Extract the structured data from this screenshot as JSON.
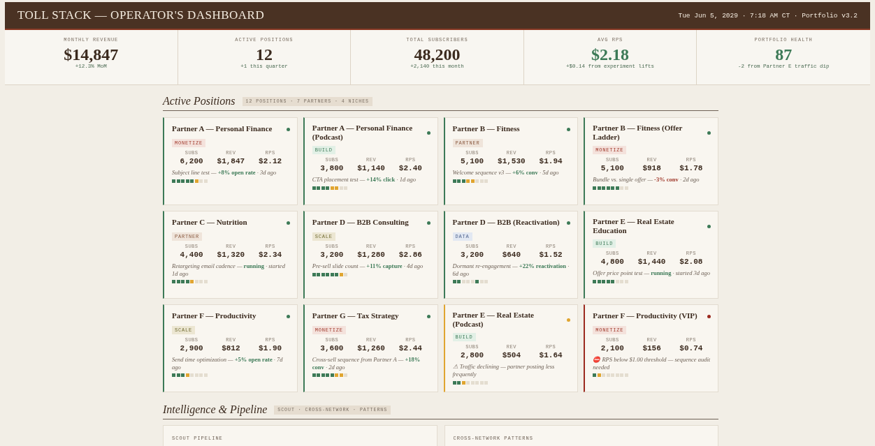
{
  "header": {
    "title": "TOLL STACK — OPERATOR'S DASHBOARD",
    "meta": "Tue Jun 5, 2029 · 7:18 AM CT · Portfolio v3.2"
  },
  "stats": [
    {
      "label": "MONTHLY REVENUE",
      "value": "$14,847",
      "delta": "+12.3% MoM",
      "highlight": false
    },
    {
      "label": "ACTIVE POSITIONS",
      "value": "12",
      "delta": "+1 this quarter",
      "highlight": false
    },
    {
      "label": "TOTAL SUBSCRIBERS",
      "value": "48,200",
      "delta": "+2,140 this month",
      "highlight": false
    },
    {
      "label": "AVG RPS",
      "value": "$2.18",
      "delta": "+$0.14 from experiment lifts",
      "highlight": true
    },
    {
      "label": "PORTFOLIO HEALTH",
      "value": "87",
      "delta": "-2 from Partner E traffic dip",
      "highlight": true
    }
  ],
  "positions": {
    "title": "Active Positions",
    "badge": "12 POSITIONS · 7 PARTNERS · 4 NICHES",
    "cards": [
      {
        "title": "Partner A — Personal Finance",
        "color": "#3d7a57",
        "tag": {
          "label": "MONETIZE",
          "kind": "monetize"
        },
        "metrics": [
          {
            "label": "SUBS",
            "value": "6,200"
          },
          {
            "label": "REV",
            "value": "$1,847"
          },
          {
            "label": "RPS",
            "value": "$2.12"
          }
        ],
        "note": "Subject line test — **+8% open rate** · 3d ago",
        "negative": false,
        "steps": [
          {
            "color": "#3d7a57"
          },
          {
            "color": "#3d7a57"
          },
          {
            "color": "#3d7a57"
          },
          {
            "color": "#3d7a57"
          },
          {
            "color": "#3d7a57"
          },
          {
            "color": "#e0a530"
          },
          {
            "color": "#e4ddd0"
          },
          {
            "color": "#e4ddd0"
          }
        ]
      },
      {
        "title": "Partner A — Personal Finance (Podcast)",
        "color": "#3d7a57",
        "tag": {
          "label": "BUILD",
          "kind": "build"
        },
        "metrics": [
          {
            "label": "SUBS",
            "value": "3,800"
          },
          {
            "label": "REV",
            "value": "$1,140"
          },
          {
            "label": "RPS",
            "value": "$2.40"
          }
        ],
        "note": "CTA placement test — **+14% click** · 1d ago",
        "negative": false,
        "steps": [
          {
            "color": "#3d7a57"
          },
          {
            "color": "#3d7a57"
          },
          {
            "color": "#3d7a57"
          },
          {
            "color": "#3d7a57"
          },
          {
            "color": "#e0a530"
          },
          {
            "color": "#e0a530"
          },
          {
            "color": "#e4ddd0"
          },
          {
            "color": "#e4ddd0"
          }
        ]
      },
      {
        "title": "Partner B — Fitness",
        "color": "#3d7a57",
        "tag": {
          "label": "PARTNER",
          "kind": "partner"
        },
        "metrics": [
          {
            "label": "SUBS",
            "value": "5,100"
          },
          {
            "label": "REV",
            "value": "$1,530"
          },
          {
            "label": "RPS",
            "value": "$1.94"
          }
        ],
        "note": "Welcome sequence v3 — **+6% conv** · 5d ago",
        "negative": false,
        "steps": [
          {
            "color": "#3d7a57"
          },
          {
            "color": "#3d7a57"
          },
          {
            "color": "#3d7a57"
          },
          {
            "color": "#e0a530"
          },
          {
            "color": "#e0a530"
          },
          {
            "color": "#e4ddd0"
          },
          {
            "color": "#e4ddd0"
          },
          {
            "color": "#e4ddd0"
          }
        ]
      },
      {
        "title": "Partner B — Fitness (Offer Ladder)",
        "color": "#3d7a57",
        "tag": {
          "label": "MONETIZE",
          "kind": "monetize"
        },
        "metrics": [
          {
            "label": "SUBS",
            "value": "5,100"
          },
          {
            "label": "REV",
            "value": "$918"
          },
          {
            "label": "RPS",
            "value": "$1.78"
          }
        ],
        "note": "Bundle vs. single offer — **-3% conv** · 2d ago",
        "negative": true,
        "steps": [
          {
            "color": "#3d7a57"
          },
          {
            "color": "#3d7a57"
          },
          {
            "color": "#3d7a57"
          },
          {
            "color": "#3d7a57"
          },
          {
            "color": "#3d7a57"
          },
          {
            "color": "#3d7a57"
          },
          {
            "color": "#e4ddd0"
          },
          {
            "color": "#e4ddd0"
          }
        ]
      },
      {
        "title": "Partner C — Nutrition",
        "color": "#3d7a57",
        "tag": {
          "label": "PARTNER",
          "kind": "partner"
        },
        "metrics": [
          {
            "label": "SUBS",
            "value": "4,400"
          },
          {
            "label": "REV",
            "value": "$1,320"
          },
          {
            "label": "RPS",
            "value": "$2.34"
          }
        ],
        "note": "Retargeting email cadence — **running** · started 1d ago",
        "negative": false,
        "steps": [
          {
            "color": "#3d7a57"
          },
          {
            "color": "#3d7a57"
          },
          {
            "color": "#3d7a57"
          },
          {
            "color": "#3d7a57"
          },
          {
            "color": "#e0a530"
          },
          {
            "color": "#e4ddd0"
          },
          {
            "color": "#e4ddd0"
          },
          {
            "color": "#e4ddd0"
          }
        ]
      },
      {
        "title": "Partner D — B2B Consulting",
        "color": "#3d7a57",
        "tag": {
          "label": "SCALE",
          "kind": "scale"
        },
        "metrics": [
          {
            "label": "SUBS",
            "value": "3,200"
          },
          {
            "label": "REV",
            "value": "$1,280"
          },
          {
            "label": "RPS",
            "value": "$2.86"
          }
        ],
        "note": "Pre-sell slide count — **+11% capture** · 4d ago",
        "negative": false,
        "steps": [
          {
            "color": "#3d7a57"
          },
          {
            "color": "#3d7a57"
          },
          {
            "color": "#3d7a57"
          },
          {
            "color": "#3d7a57"
          },
          {
            "color": "#3d7a57"
          },
          {
            "color": "#3d7a57"
          },
          {
            "color": "#e0a530"
          },
          {
            "color": "#e4ddd0"
          }
        ]
      },
      {
        "title": "Partner D — B2B (Reactivation)",
        "color": "#3d7a57",
        "tag": {
          "label": "DATA",
          "kind": "data"
        },
        "metrics": [
          {
            "label": "SUBS",
            "value": "3,200"
          },
          {
            "label": "REV",
            "value": "$640"
          },
          {
            "label": "RPS",
            "value": "$1.52"
          }
        ],
        "note": "Dormant re-engagement — **+22% reactivation** · 6d ago",
        "negative": false,
        "steps": [
          {
            "color": "#3d7a57"
          },
          {
            "color": "#3d7a57"
          },
          {
            "color": "#e4ddd0"
          },
          {
            "color": "#e4ddd0"
          },
          {
            "color": "#e4ddd0"
          },
          {
            "color": "#3d7a57"
          },
          {
            "color": "#e4ddd0"
          },
          {
            "color": "#e4ddd0"
          }
        ]
      },
      {
        "title": "Partner E — Real Estate Education",
        "color": "#3d7a57",
        "tag": {
          "label": "BUILD",
          "kind": "build"
        },
        "metrics": [
          {
            "label": "SUBS",
            "value": "4,800"
          },
          {
            "label": "REV",
            "value": "$1,440"
          },
          {
            "label": "RPS",
            "value": "$2.08"
          }
        ],
        "note": "Offer price point test — **running** · started 3d ago",
        "negative": false,
        "steps": [
          {
            "color": "#3d7a57"
          },
          {
            "color": "#3d7a57"
          },
          {
            "color": "#3d7a57"
          },
          {
            "color": "#3d7a57"
          },
          {
            "color": "#3d7a57"
          },
          {
            "color": "#e4ddd0"
          },
          {
            "color": "#e4ddd0"
          },
          {
            "color": "#e4ddd0"
          }
        ]
      },
      {
        "title": "Partner F — Productivity",
        "color": "#3d7a57",
        "tag": {
          "label": "SCALE",
          "kind": "scale"
        },
        "metrics": [
          {
            "label": "SUBS",
            "value": "2,900"
          },
          {
            "label": "REV",
            "value": "$812"
          },
          {
            "label": "RPS",
            "value": "$1.90"
          }
        ],
        "note": "Send time optimization — **+5% open rate** · 7d ago",
        "negative": false,
        "steps": [
          {
            "color": "#3d7a57"
          },
          {
            "color": "#3d7a57"
          },
          {
            "color": "#3d7a57"
          },
          {
            "color": "#e0a530"
          },
          {
            "color": "#e4ddd0"
          },
          {
            "color": "#e4ddd0"
          },
          {
            "color": "#e4ddd0"
          },
          {
            "color": "#e4ddd0"
          }
        ]
      },
      {
        "title": "Partner G — Tax Strategy",
        "color": "#3d7a57",
        "tag": {
          "label": "MONETIZE",
          "kind": "monetize"
        },
        "metrics": [
          {
            "label": "SUBS",
            "value": "3,600"
          },
          {
            "label": "REV",
            "value": "$1,260"
          },
          {
            "label": "RPS",
            "value": "$2.44"
          }
        ],
        "note": "Cross-sell sequence from Partner A — **+18% conv** · 2d ago",
        "negative": false,
        "steps": [
          {
            "color": "#3d7a57"
          },
          {
            "color": "#3d7a57"
          },
          {
            "color": "#3d7a57"
          },
          {
            "color": "#3d7a57"
          },
          {
            "color": "#3d7a57"
          },
          {
            "color": "#e0a530"
          },
          {
            "color": "#e0a530"
          },
          {
            "color": "#e4ddd0"
          }
        ]
      },
      {
        "title": "Partner E — Real Estate (Podcast)",
        "color": "#e0a530",
        "tag": {
          "label": "BUILD",
          "kind": "build"
        },
        "metrics": [
          {
            "label": "SUBS",
            "value": "2,800"
          },
          {
            "label": "REV",
            "value": "$504"
          },
          {
            "label": "RPS",
            "value": "$1.64"
          }
        ],
        "note": "⚠ Traffic declining — partner posting less frequently",
        "steps": [
          {
            "color": "#3d7a57"
          },
          {
            "color": "#3d7a57"
          },
          {
            "color": "#e0a530"
          },
          {
            "color": "#e4ddd0"
          },
          {
            "color": "#e4ddd0"
          },
          {
            "color": "#e4ddd0"
          },
          {
            "color": "#e4ddd0"
          },
          {
            "color": "#e4ddd0"
          }
        ]
      },
      {
        "title": "Partner F — Productivity (VIP)",
        "color": "#9b2a1f",
        "tag": {
          "label": "MONETIZE",
          "kind": "monetize"
        },
        "metrics": [
          {
            "label": "SUBS",
            "value": "2,100"
          },
          {
            "label": "REV",
            "value": "$156"
          },
          {
            "label": "RPS",
            "value": "$0.74"
          }
        ],
        "note": "⛔ RPS below $1.00 threshold — sequence audit needed",
        "steps": [
          {
            "color": "#3d7a57"
          },
          {
            "color": "#e0a530"
          },
          {
            "color": "#e4ddd0"
          },
          {
            "color": "#e4ddd0"
          },
          {
            "color": "#e4ddd0"
          },
          {
            "color": "#e4ddd0"
          },
          {
            "color": "#e4ddd0"
          },
          {
            "color": "#e4ddd0"
          }
        ]
      }
    ]
  },
  "intelligence": {
    "title": "Intelligence & Pipeline",
    "badge": "SCOUT · CROSS-NETWORK · PATTERNS",
    "panels": [
      "SCOUT PIPELINE",
      "CROSS-NETWORK PATTERNS"
    ]
  }
}
